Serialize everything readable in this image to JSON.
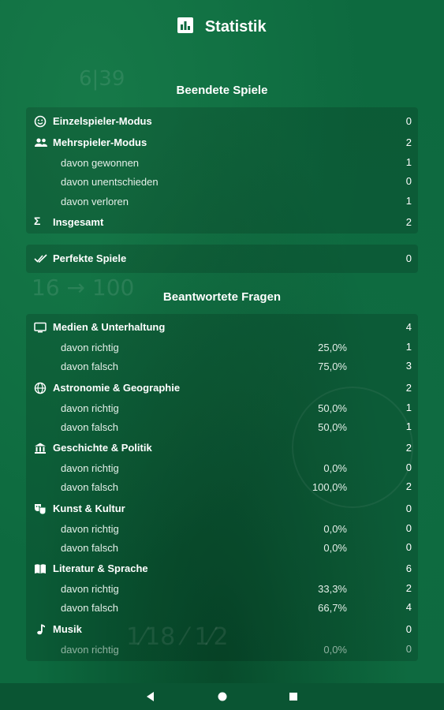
{
  "header": {
    "title": "Statistik"
  },
  "sections": {
    "finished_games": "Beendete Spiele",
    "answered_questions": "Beantwortete Fragen"
  },
  "games": {
    "single": {
      "label": "Einzelspieler-Modus",
      "value": "0"
    },
    "multi": {
      "label": "Mehrspieler-Modus",
      "value": "2"
    },
    "won": {
      "label": "davon gewonnen",
      "value": "1"
    },
    "draw": {
      "label": "davon unentschieden",
      "value": "0"
    },
    "lost": {
      "label": "davon verloren",
      "value": "1"
    },
    "total": {
      "label": "Insgesamt",
      "value": "2"
    },
    "perfect": {
      "label": "Perfekte Spiele",
      "value": "0"
    }
  },
  "categories": [
    {
      "name": "Medien & Unterhaltung",
      "icon": "tv-icon",
      "total": "4",
      "correct": {
        "label": "davon richtig",
        "pct": "25,0%",
        "value": "1"
      },
      "wrong": {
        "label": "davon falsch",
        "pct": "75,0%",
        "value": "3"
      }
    },
    {
      "name": "Astronomie & Geographie",
      "icon": "globe-icon",
      "total": "2",
      "correct": {
        "label": "davon richtig",
        "pct": "50,0%",
        "value": "1"
      },
      "wrong": {
        "label": "davon falsch",
        "pct": "50,0%",
        "value": "1"
      }
    },
    {
      "name": "Geschichte & Politik",
      "icon": "museum-icon",
      "total": "2",
      "correct": {
        "label": "davon richtig",
        "pct": "0,0%",
        "value": "0"
      },
      "wrong": {
        "label": "davon falsch",
        "pct": "100,0%",
        "value": "2"
      }
    },
    {
      "name": "Kunst & Kultur",
      "icon": "theater-masks-icon",
      "total": "0",
      "correct": {
        "label": "davon richtig",
        "pct": "0,0%",
        "value": "0"
      },
      "wrong": {
        "label": "davon falsch",
        "pct": "0,0%",
        "value": "0"
      }
    },
    {
      "name": "Literatur & Sprache",
      "icon": "book-icon",
      "total": "6",
      "correct": {
        "label": "davon richtig",
        "pct": "33,3%",
        "value": "2"
      },
      "wrong": {
        "label": "davon falsch",
        "pct": "66,7%",
        "value": "4"
      }
    },
    {
      "name": "Musik",
      "icon": "music-note-icon",
      "total": "0",
      "correct": {
        "label": "davon richtig",
        "pct": "0,0%",
        "value": "0"
      }
    }
  ],
  "navbar": {
    "icons": [
      "back-icon",
      "home-icon",
      "recents-icon"
    ]
  }
}
